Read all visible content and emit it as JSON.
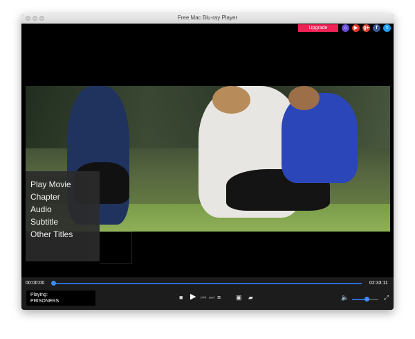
{
  "window": {
    "title": "Free Mac Blu-ray Player"
  },
  "toolbar": {
    "upgrade_label": "Upgrade",
    "social": [
      {
        "name": "home-icon",
        "color": "#6a4fd8",
        "glyph": "⌂"
      },
      {
        "name": "youtube-icon",
        "color": "#e33b2e",
        "glyph": "▶"
      },
      {
        "name": "google-plus-icon",
        "color": "#dd4b39",
        "glyph": "g+"
      },
      {
        "name": "facebook-icon",
        "color": "#3b5998",
        "glyph": "f"
      },
      {
        "name": "twitter-icon",
        "color": "#1da1f2",
        "glyph": "t"
      }
    ]
  },
  "menu": {
    "items": [
      "Play Movie",
      "Chapter",
      "Audio",
      "Subtitle",
      "Other Titles"
    ]
  },
  "player": {
    "current_time": "00:00:00",
    "total_time": "02:33:11",
    "playing_label": "Playing:",
    "playing_title": "PRISONERS",
    "progress": 0.0,
    "volume": 0.55
  },
  "colors": {
    "accent": "#2b6bd0",
    "upgrade": "#ee2255"
  }
}
